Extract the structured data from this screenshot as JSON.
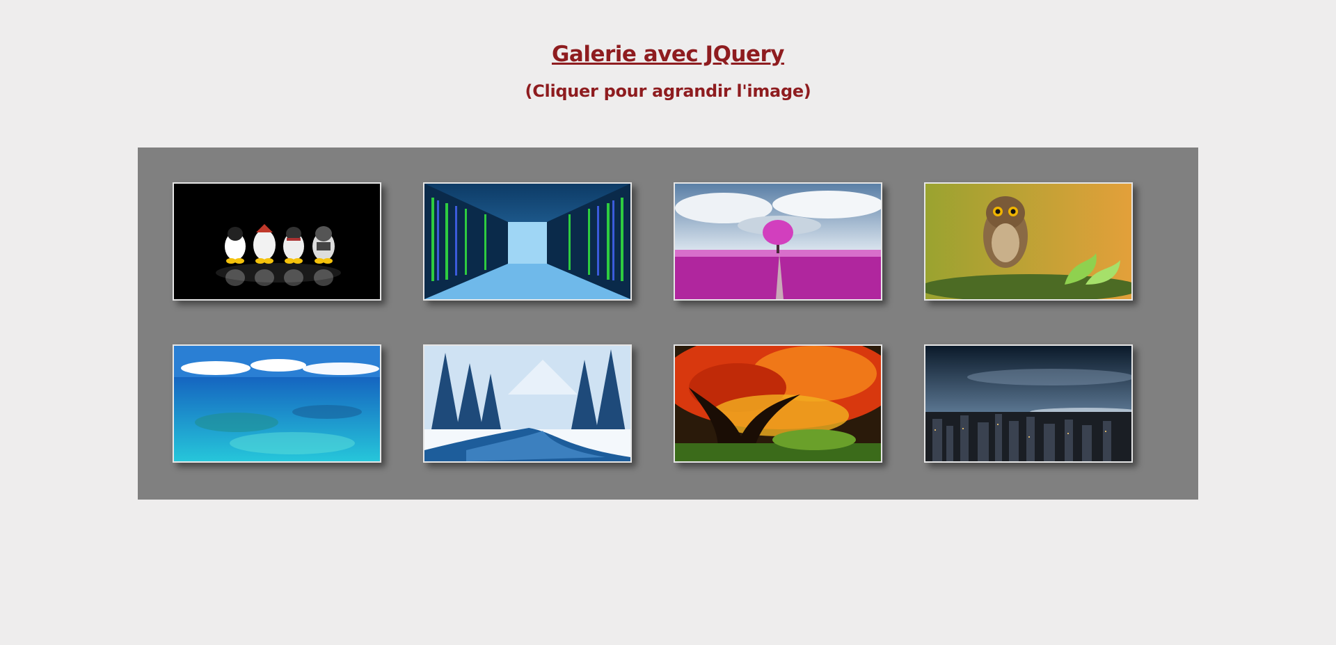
{
  "page": {
    "title": "Galerie avec JQuery",
    "subtitle": "(Cliquer pour agrandir l'image)"
  },
  "gallery": {
    "images": [
      {
        "name": "linux-penguins",
        "subject": "four penguin mascots on black"
      },
      {
        "name": "server-room",
        "subject": "data center corridor"
      },
      {
        "name": "pink-tree-field",
        "subject": "pink tree in pink field"
      },
      {
        "name": "owl",
        "subject": "owl on mossy branch"
      },
      {
        "name": "tropical-sea",
        "subject": "turquoise sea under clouds"
      },
      {
        "name": "snowy-forest-river",
        "subject": "river through snowy forest"
      },
      {
        "name": "autumn-maple",
        "subject": "red autumn maple tree"
      },
      {
        "name": "city-night",
        "subject": "city skyline at dusk"
      }
    ]
  },
  "colors": {
    "heading": "#8e1c1f",
    "background": "#eeeded",
    "gallery_bg": "#808080",
    "thumb_border": "#e6e6e6"
  }
}
